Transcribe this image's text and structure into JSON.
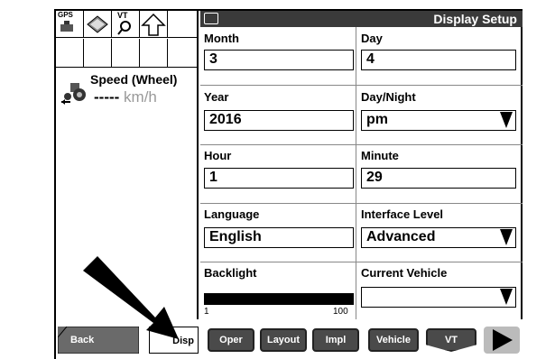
{
  "top_icons": {
    "gps_label": "GPS",
    "vt_label": "VT"
  },
  "speed": {
    "label": "Speed (Wheel)",
    "value": "-----",
    "unit": "km/h"
  },
  "title": "Display Setup",
  "fields": {
    "month": {
      "label": "Month",
      "value": "3"
    },
    "day": {
      "label": "Day",
      "value": "4"
    },
    "year": {
      "label": "Year",
      "value": "2016"
    },
    "day_night": {
      "label": "Day/Night",
      "value": "pm"
    },
    "hour": {
      "label": "Hour",
      "value": "1"
    },
    "minute": {
      "label": "Minute",
      "value": "29"
    },
    "language": {
      "label": "Language",
      "value": "English"
    },
    "interface_level": {
      "label": "Interface Level",
      "value": "Advanced"
    },
    "backlight": {
      "label": "Backlight",
      "min": "1",
      "max": "100",
      "level": 1.0
    },
    "current_vehicle": {
      "label": "Current Vehicle",
      "value": ""
    }
  },
  "bottom": {
    "back": "Back",
    "disp": "Disp",
    "oper": "Oper",
    "layout": "Layout",
    "impl": "Impl",
    "vehicle": "Vehicle",
    "vt": "VT"
  }
}
